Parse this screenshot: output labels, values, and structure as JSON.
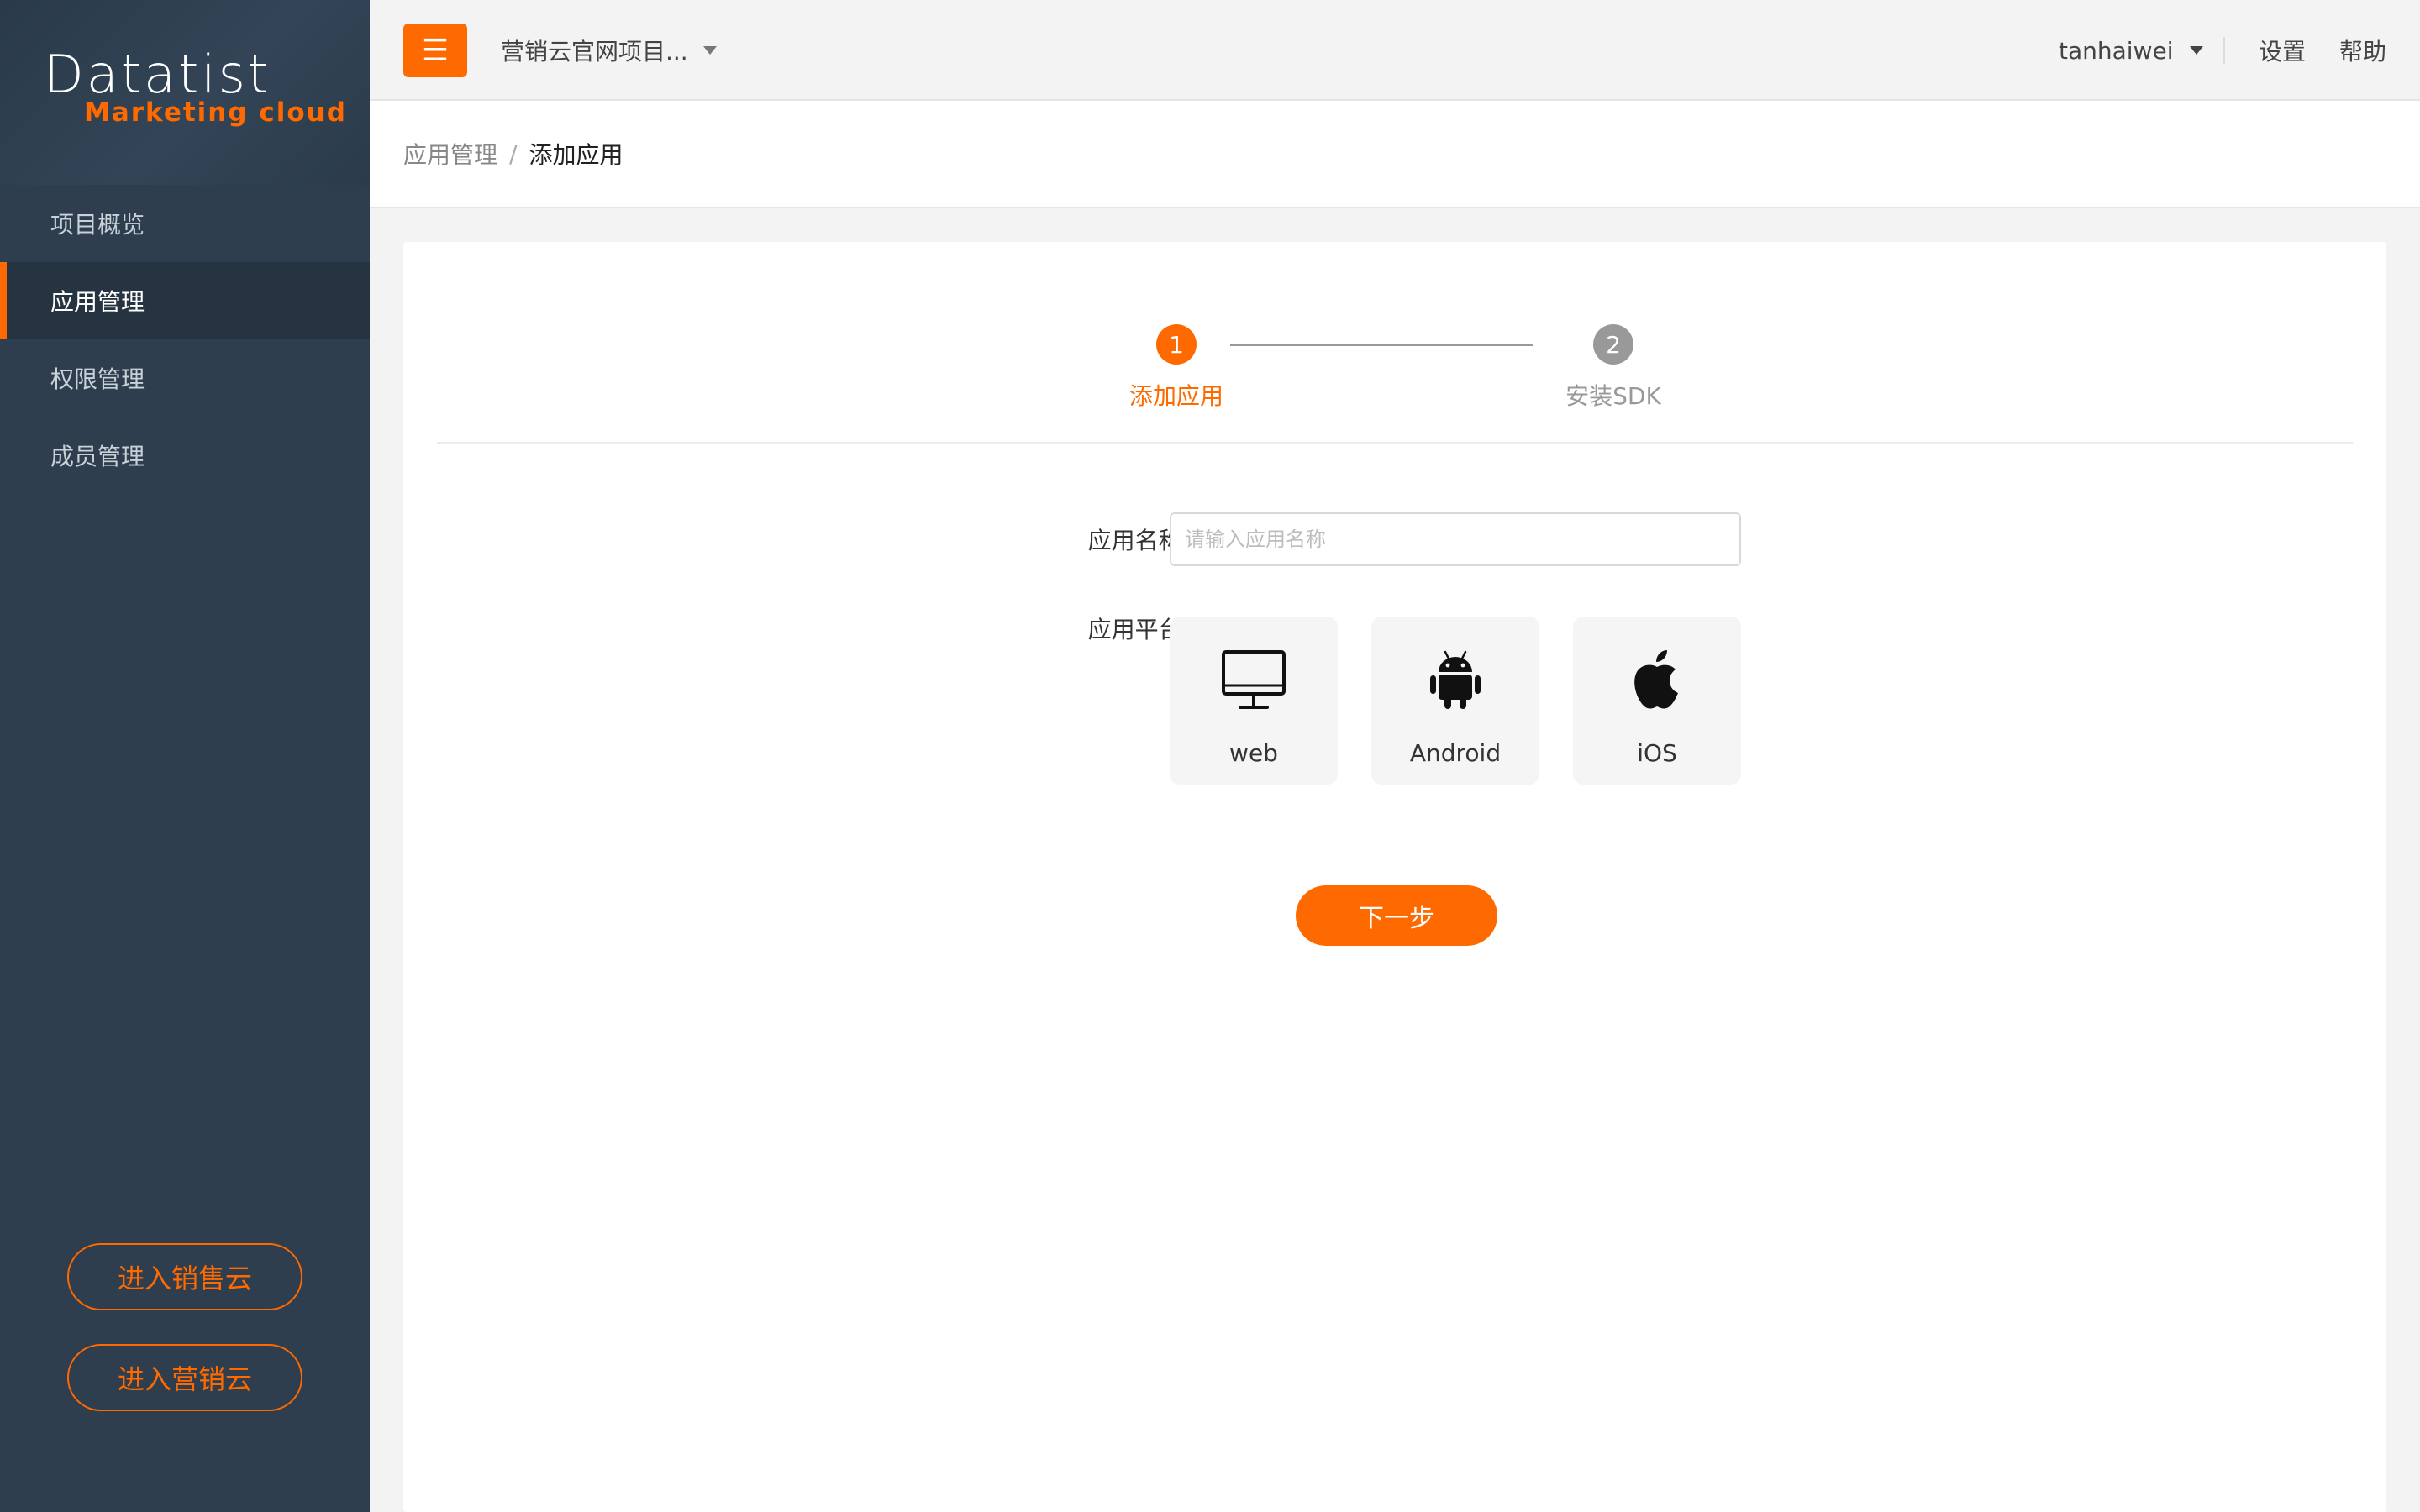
{
  "sidebar": {
    "logo": {
      "main": "Datatist",
      "sub": "Marketing cloud"
    },
    "nav": [
      {
        "label": "项目概览",
        "active": false
      },
      {
        "label": "应用管理",
        "active": true
      },
      {
        "label": "权限管理",
        "active": false
      },
      {
        "label": "成员管理",
        "active": false
      }
    ],
    "buttons": {
      "sales_cloud": "进入销售云",
      "marketing_cloud": "进入营销云"
    }
  },
  "header": {
    "menu_icon": "hamburger-icon",
    "project_name": "营销云官网项目...",
    "username": "tanhaiwei",
    "settings": "设置",
    "help": "帮助"
  },
  "breadcrumb": {
    "parent": "应用管理",
    "separator": "/",
    "current": "添加应用"
  },
  "steps": [
    {
      "number": "1",
      "label": "添加应用",
      "active": true
    },
    {
      "number": "2",
      "label": "安装SDK",
      "active": false
    }
  ],
  "form": {
    "name_label": "应用名称:",
    "name_value": "",
    "name_placeholder": "请输入应用名称",
    "platform_label": "应用平台:",
    "platforms": [
      {
        "label": "web",
        "icon": "monitor-icon"
      },
      {
        "label": "Android",
        "icon": "android-icon"
      },
      {
        "label": "iOS",
        "icon": "apple-icon"
      }
    ],
    "next_button": "下一步"
  },
  "colors": {
    "accent": "#ff6a00",
    "sidebar_bg": "#2e3e4e",
    "sidebar_active_bg": "#263442",
    "inactive_step": "#999999"
  }
}
